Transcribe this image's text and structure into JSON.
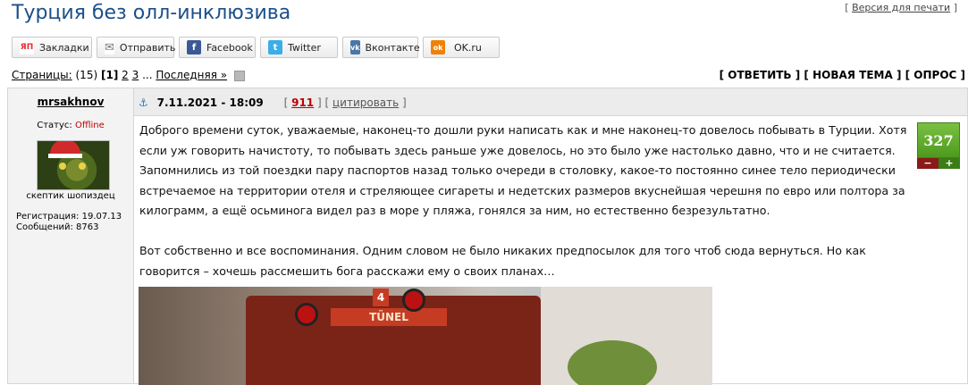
{
  "page": {
    "title": "Турция без олл-инклюзива",
    "print_version": "Версия для печати"
  },
  "share": [
    {
      "label": "Закладки",
      "icon": "yandex-bookmarks-icon",
      "color": "#e8272e",
      "glyph": "ЯП"
    },
    {
      "label": "Отправить",
      "icon": "mail-icon",
      "color": "#888888",
      "glyph": "✉"
    },
    {
      "label": "Facebook",
      "icon": "facebook-icon",
      "color": "#3b5998",
      "glyph": "f"
    },
    {
      "label": "Twitter",
      "icon": "twitter-icon",
      "color": "#3aaee6",
      "glyph": "t"
    },
    {
      "label": "Вконтакте",
      "icon": "vk-icon",
      "color": "#4a76a8",
      "glyph": "vk"
    },
    {
      "label": "OK.ru",
      "icon": "odnoklassniki-icon",
      "color": "#ee8208",
      "glyph": "ok"
    }
  ],
  "pager": {
    "label": "Страницы:",
    "count": "(15)",
    "current": "1",
    "pages": [
      "2",
      "3"
    ],
    "ellipsis": "...",
    "last": "Последняя »"
  },
  "actions": "[ ОТВЕТИТЬ ] [ НОВАЯ ТЕМА ] [ ОПРОС ]",
  "post": {
    "author": "mrsakhnov",
    "status_label": "Статус:",
    "status_value": "Offline",
    "rank": "скептик шопиздец",
    "reg": "Регистрация: 19.07.13",
    "messages": "Сообщений: 8763",
    "date": "7.11.2021 - 18:09",
    "post_number": "911",
    "quote": "цитировать",
    "rating": "327",
    "paragraphs": [
      "Доброго времени суток, уважаемые, наконец-то дошли руки написать как и мне наконец-то довелось побывать в Турции. Хотя если уж говорить начистоту, то побывать здесь раньше уже довелось, но это было уже настолько давно, что и не считается. Запомнились из той поездки пару паспортов назад только очереди в столовку, какое-то постоянно синее тело периодически встречаемое на территории отеля и стреляющее сигареты и недетских размеров вкуснейшая черешня по евро или полтора за килограмм, а ещё осьминога видел раз в море у пляжа, гонялся за ним, но естественно безрезультатно.",
      "Вот собственно и все воспоминания. Одним словом не было никаких предпосылок для того чтоб сюда вернуться. Но как говорится – хочешь рассмешить бога расскажи ему о своих планах…"
    ],
    "photo_sign": "TÜNEL",
    "photo_num": "4"
  }
}
